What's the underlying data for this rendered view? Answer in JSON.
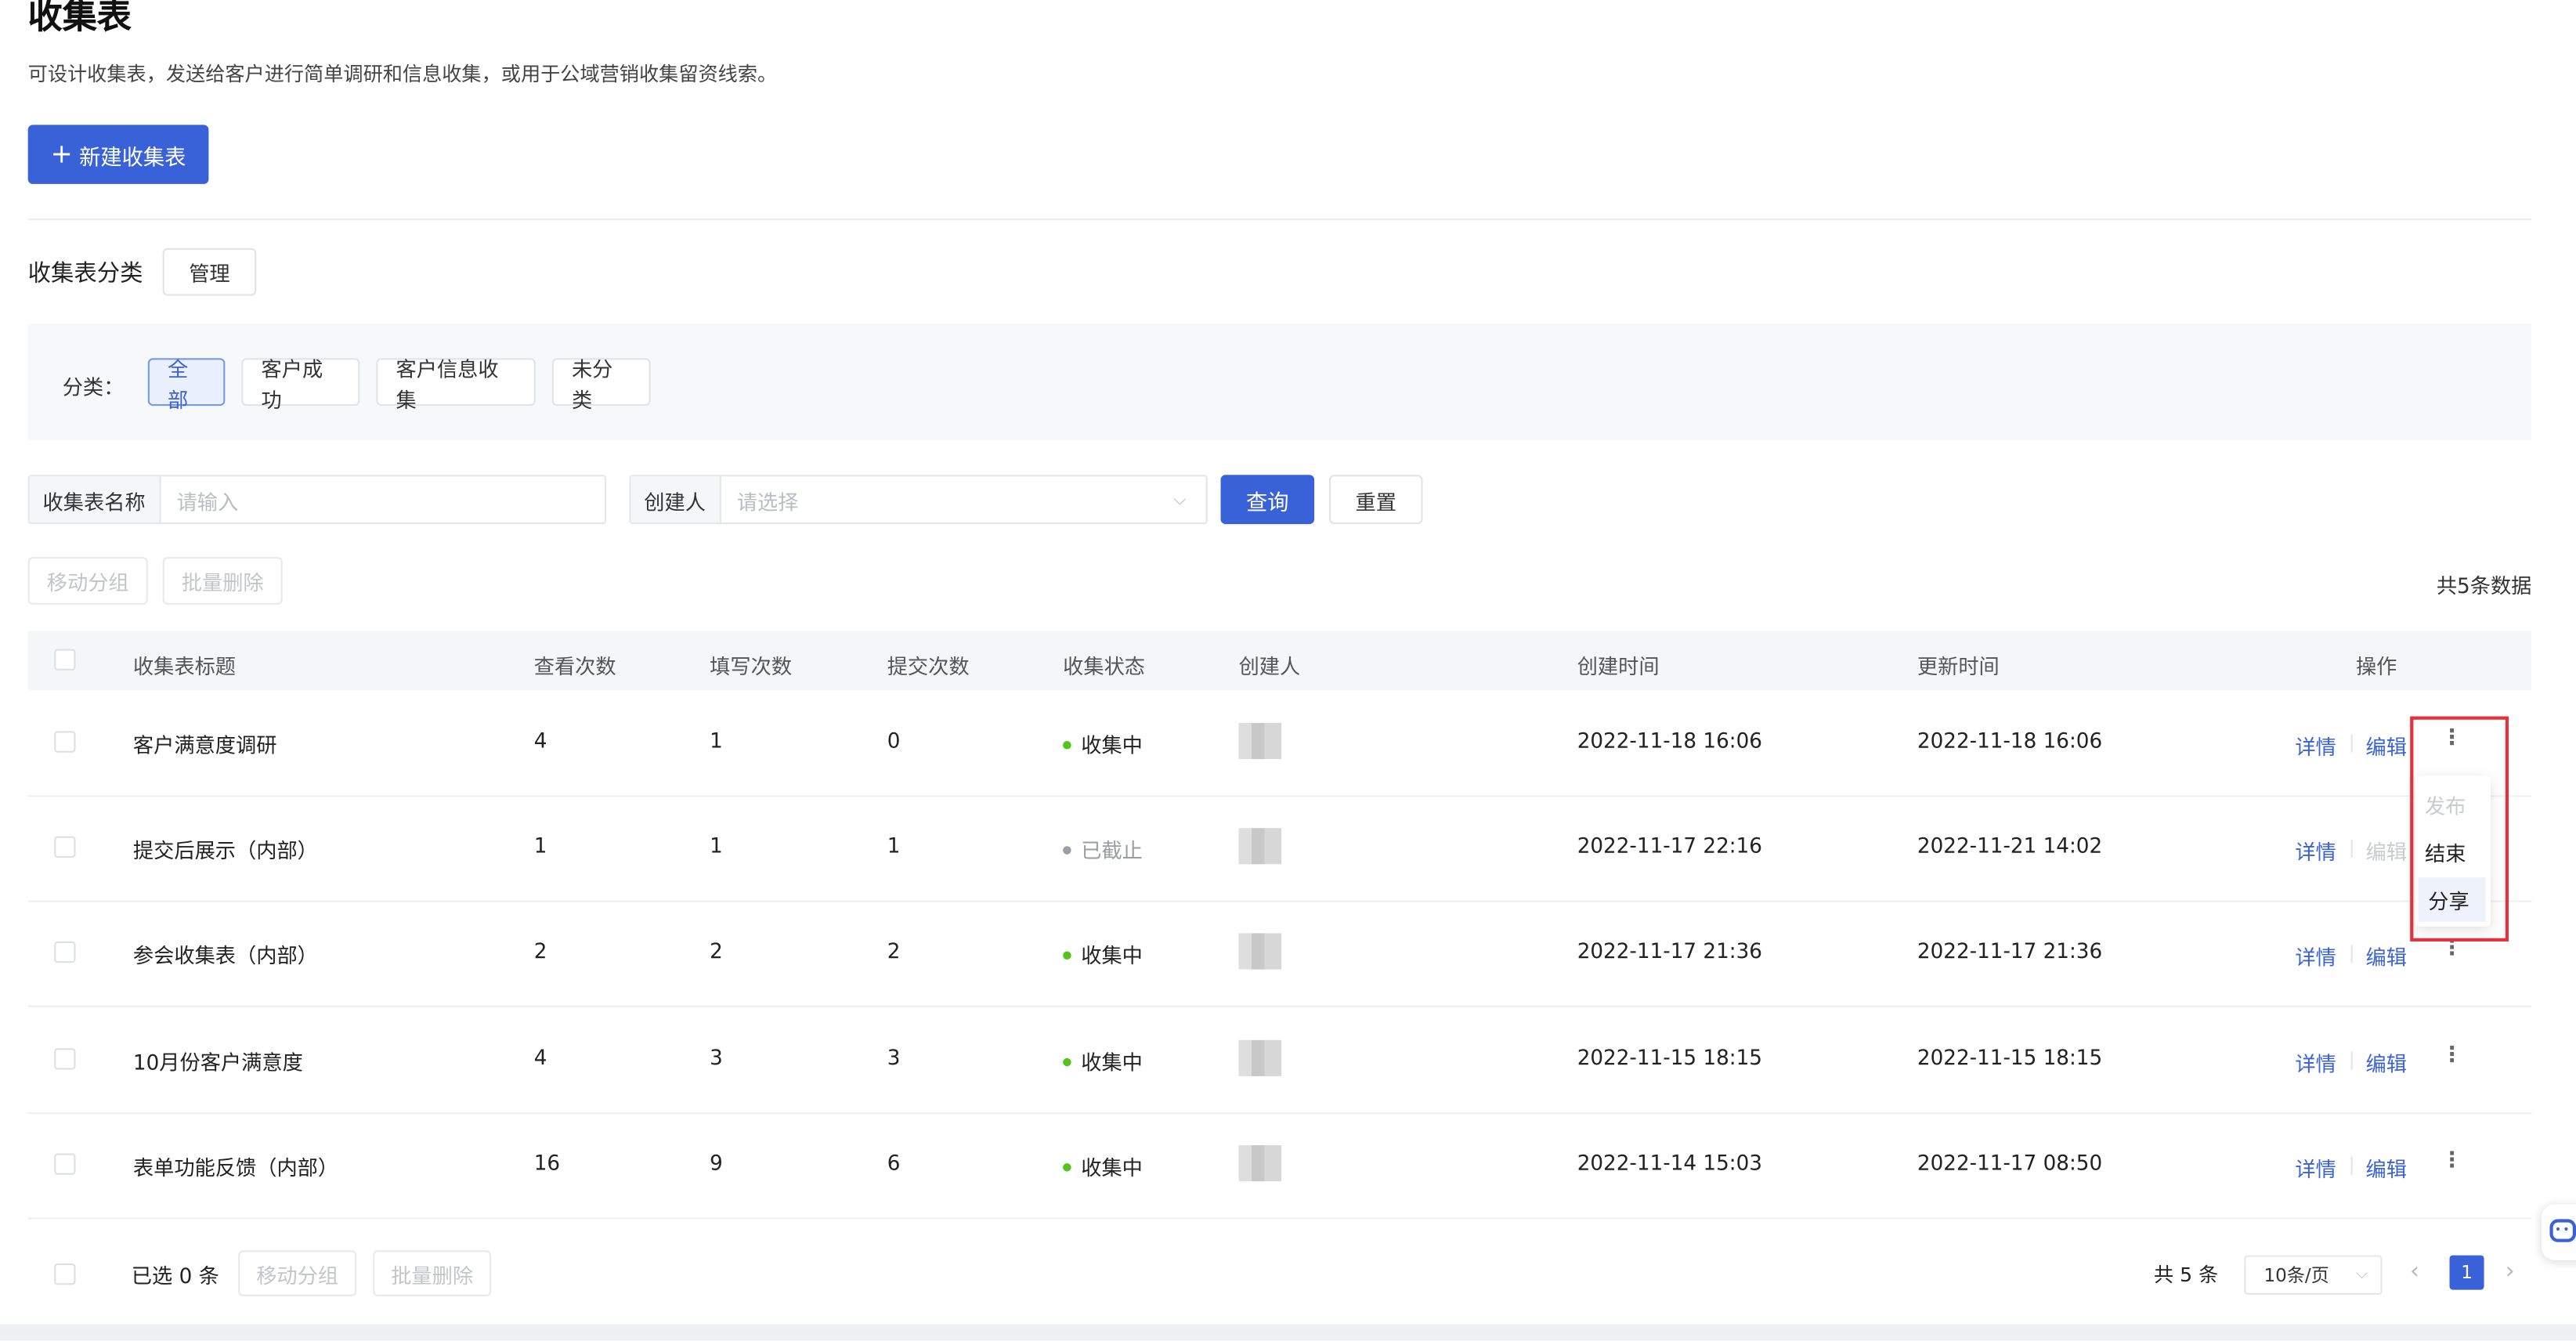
{
  "page": {
    "title": "收集表",
    "description": "可设计收集表，发送给客户进行简单调研和信息收集，或用于公域营销收集留资线索。",
    "new_button": "新建收集表",
    "new_icon": "plus-icon"
  },
  "category": {
    "title": "收集表分类",
    "manage": "管理",
    "filter_label": "分类：",
    "chips": [
      "全部",
      "客户成功",
      "客户信息收集",
      "未分类"
    ]
  },
  "search": {
    "name_label": "收集表名称",
    "name_placeholder": "请输入",
    "creator_label": "创建人",
    "creator_placeholder": "请选择",
    "query": "查询",
    "reset": "重置"
  },
  "batch": {
    "move": "移动分组",
    "delete": "批量删除",
    "total": "共5条数据"
  },
  "table": {
    "headers": [
      "收集表标题",
      "查看次数",
      "填写次数",
      "提交次数",
      "收集状态",
      "创建人",
      "创建时间",
      "更新时间",
      "操作"
    ],
    "rows": [
      {
        "title": "客户满意度调研",
        "views": "4",
        "fills": "1",
        "submits": "0",
        "status": "收集中",
        "created": "2022-11-18 16:06",
        "updated": "2022-11-18 16:06",
        "detail": "详情",
        "edit": "编辑"
      },
      {
        "title": "提交后展示（内部）",
        "views": "1",
        "fills": "1",
        "submits": "1",
        "status": "已截止",
        "created": "2022-11-17 22:16",
        "updated": "2022-11-21 14:02",
        "detail": "详情",
        "edit": "编辑"
      },
      {
        "title": "参会收集表（内部）",
        "views": "2",
        "fills": "2",
        "submits": "2",
        "status": "收集中",
        "created": "2022-11-17 21:36",
        "updated": "2022-11-17 21:36",
        "detail": "详情",
        "edit": "编辑"
      },
      {
        "title": "10月份客户满意度",
        "views": "4",
        "fills": "3",
        "submits": "3",
        "status": "收集中",
        "created": "2022-11-15 18:15",
        "updated": "2022-11-15 18:15",
        "detail": "详情",
        "edit": "编辑"
      },
      {
        "title": "表单功能反馈（内部）",
        "views": "16",
        "fills": "9",
        "submits": "6",
        "status": "收集中",
        "created": "2022-11-14 15:03",
        "updated": "2022-11-17 08:50",
        "detail": "详情",
        "edit": "编辑"
      }
    ],
    "status_colors": {
      "active": "#52c41a",
      "closed": "#9a9da3"
    }
  },
  "menu": {
    "items": [
      "发布",
      "结束",
      "分享"
    ]
  },
  "footer": {
    "selected": "已选 0 条",
    "move": "移动分组",
    "delete": "批量删除",
    "total": "共 5 条",
    "page_size": "10条/页",
    "page": "1"
  },
  "colors": {
    "primary": "#3a62d8",
    "highlight_box": "#e8303a"
  }
}
